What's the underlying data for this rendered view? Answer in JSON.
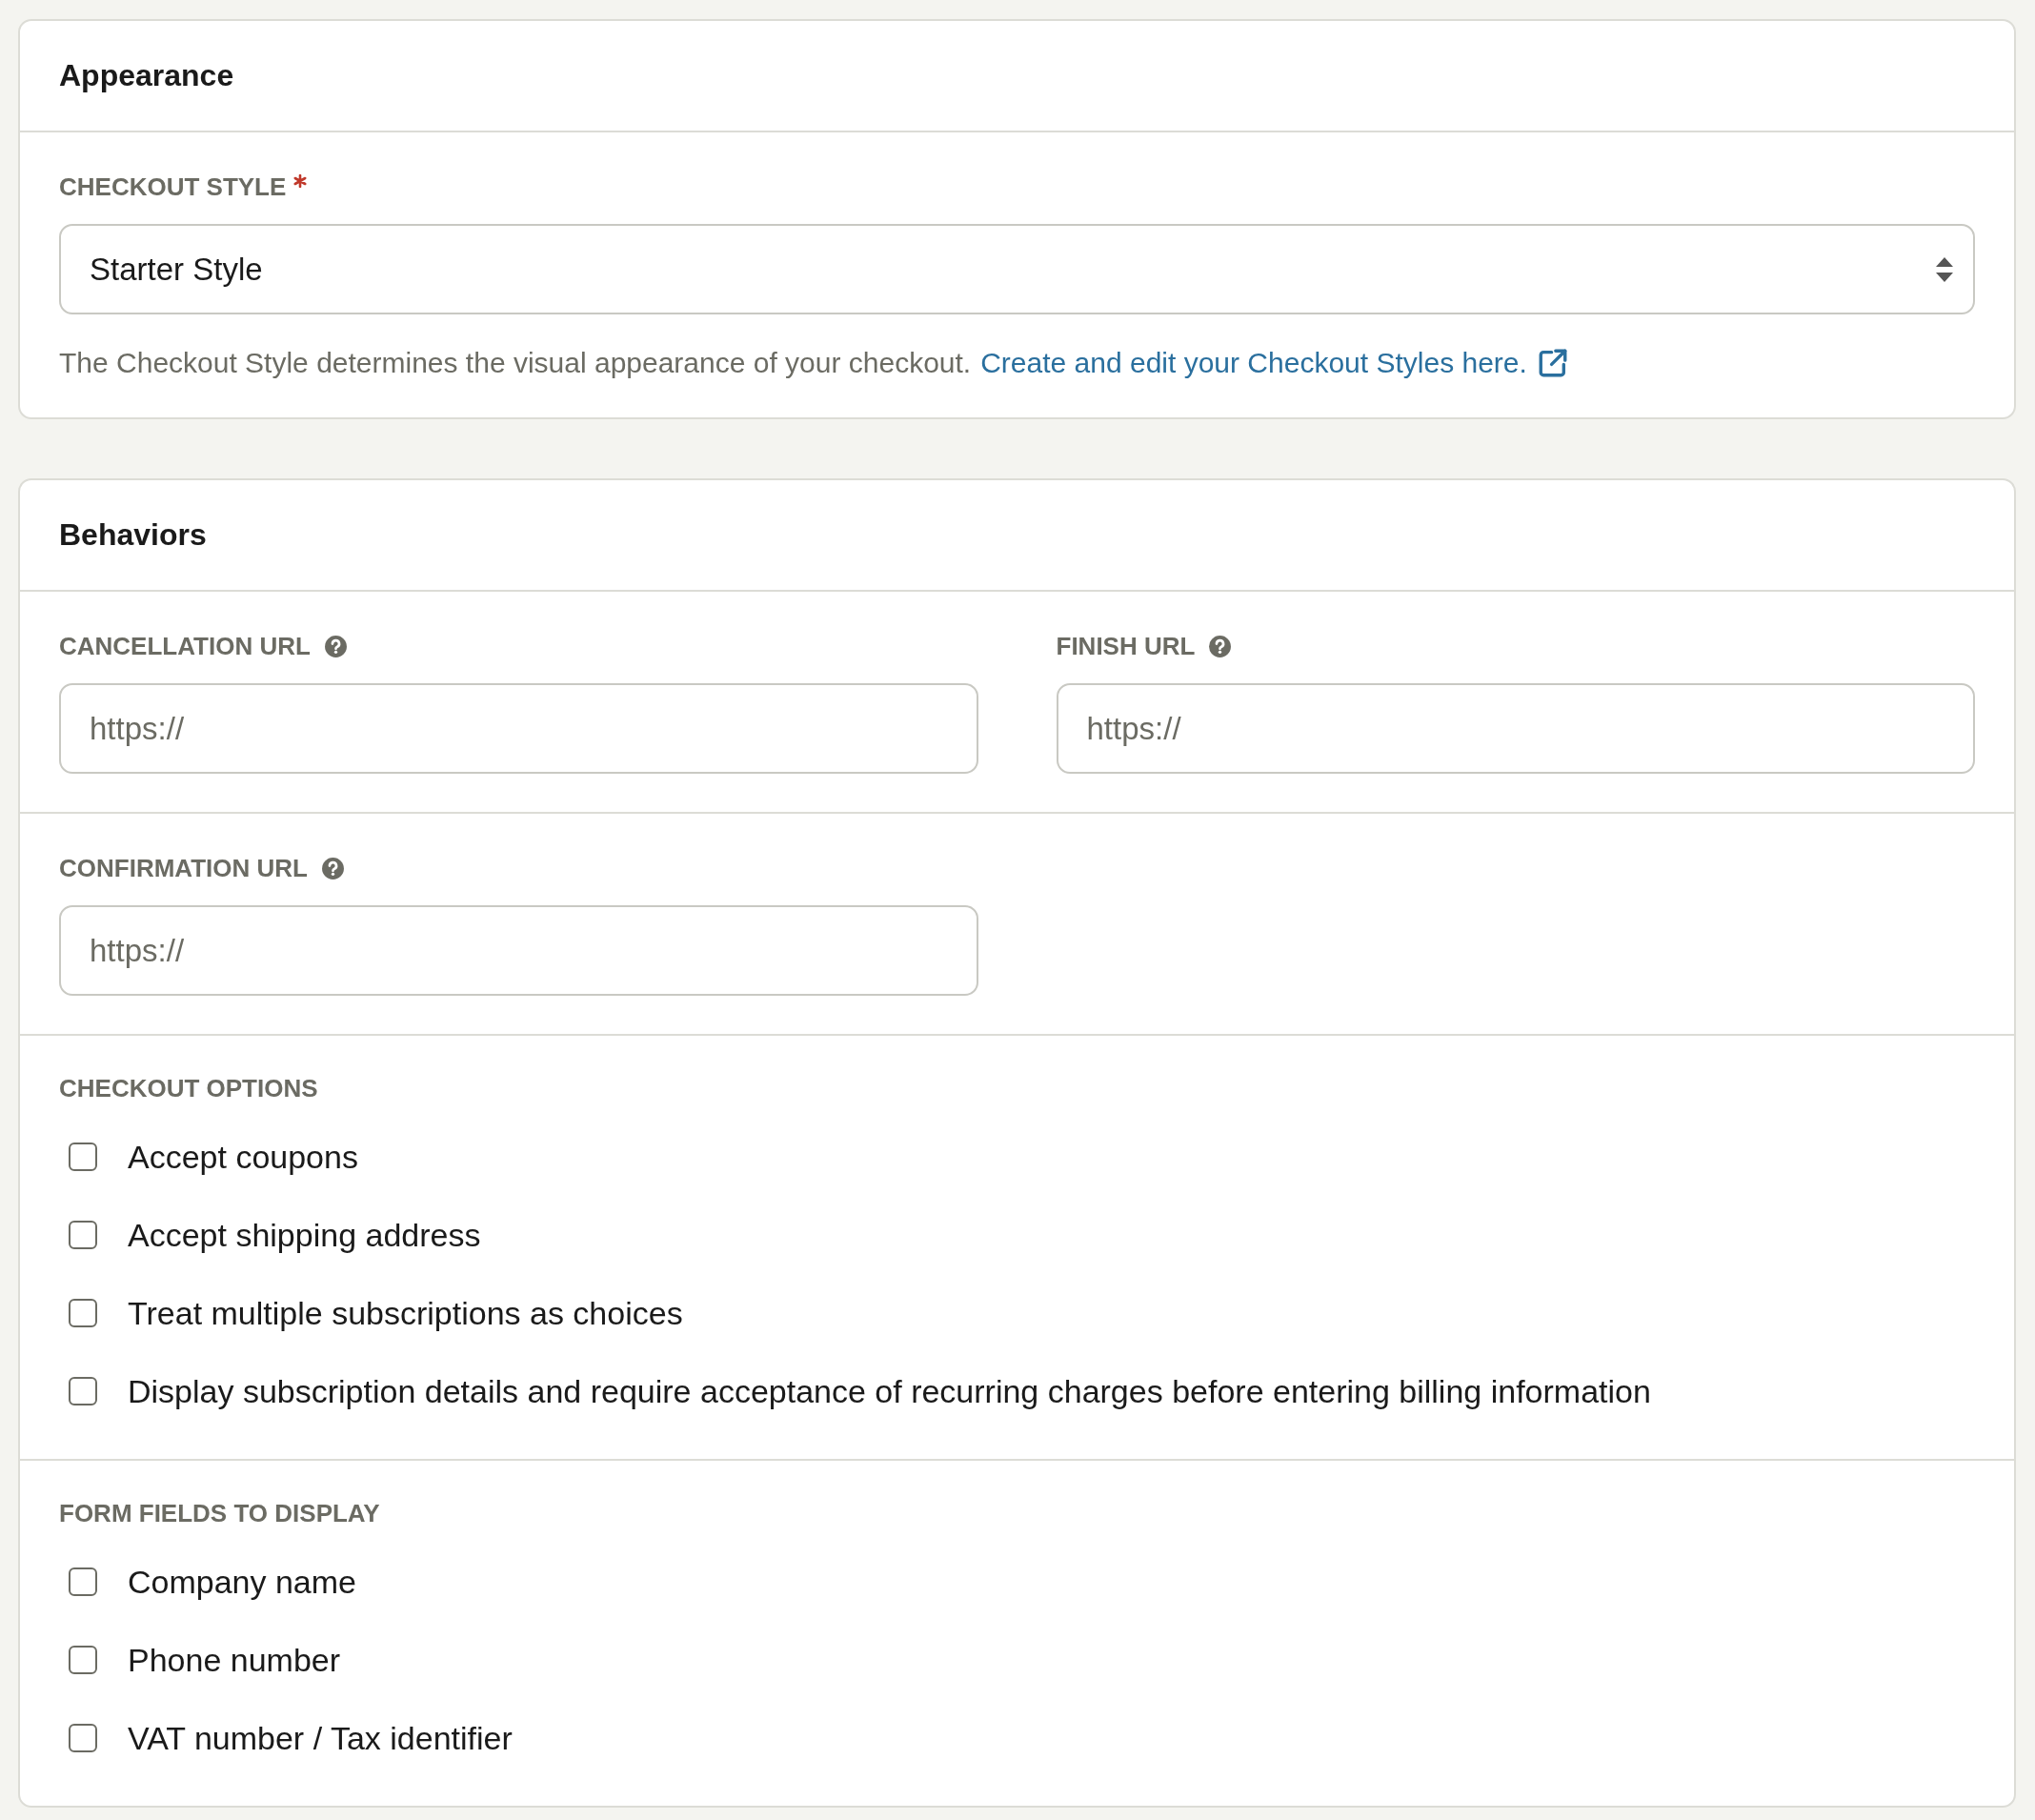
{
  "appearance": {
    "title": "Appearance",
    "checkout_style": {
      "label": "CHECKOUT STYLE",
      "required": true,
      "value": "Starter Style",
      "help": "The Checkout Style determines the visual appearance of your checkout.",
      "link": "Create and edit your Checkout Styles here."
    }
  },
  "behaviors": {
    "title": "Behaviors",
    "url_rows": [
      {
        "fields": [
          {
            "label": "CANCELLATION URL",
            "has_help": true,
            "placeholder": "https://"
          },
          {
            "label": "FINISH URL",
            "has_help": true,
            "placeholder": "https://"
          }
        ]
      },
      {
        "fields": [
          {
            "label": "CONFIRMATION URL",
            "has_help": true,
            "placeholder": "https://"
          }
        ]
      }
    ],
    "checkbox_groups": [
      {
        "label": "CHECKOUT OPTIONS",
        "options": [
          {
            "label": "Accept coupons",
            "checked": false
          },
          {
            "label": "Accept shipping address",
            "checked": false
          },
          {
            "label": "Treat multiple subscriptions as choices",
            "checked": false
          },
          {
            "label": "Display subscription details and require acceptance of recurring charges before entering billing information",
            "checked": false
          }
        ]
      },
      {
        "label": "FORM FIELDS TO DISPLAY",
        "options": [
          {
            "label": "Company name",
            "checked": false
          },
          {
            "label": "Phone number",
            "checked": false
          },
          {
            "label": "VAT number / Tax identifier",
            "checked": false
          }
        ]
      }
    ]
  }
}
